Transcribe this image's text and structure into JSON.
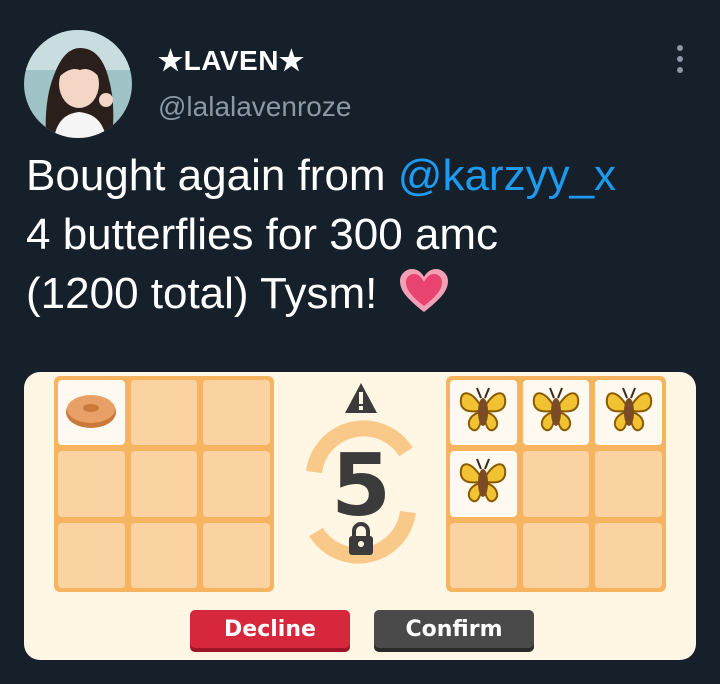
{
  "author": {
    "display_name": "★LAVEN★",
    "handle": "@lalalavenroze",
    "avatar": "avatar"
  },
  "menu_icon": "more-options-icon",
  "tweet": {
    "line1_text": "Bought again from ",
    "mention": "@karzyy_x",
    "line2": "4 butterflies for 300 amc",
    "line3": "(1200 total) Tysm! ",
    "emoji": "heart-emoji"
  },
  "trade": {
    "left_items": [
      "donut",
      "",
      "",
      "",
      "",
      "",
      "",
      "",
      ""
    ],
    "right_items": [
      "butterfly",
      "butterfly",
      "butterfly",
      "butterfly",
      "",
      "",
      "",
      "",
      ""
    ],
    "timer": "5",
    "decline_label": "Decline",
    "confirm_label": "Confirm",
    "colors": {
      "decline": "#d7273c",
      "confirm": "#4a4a4a",
      "grid": "#f5b460",
      "slot": "#fbd2a2"
    }
  }
}
